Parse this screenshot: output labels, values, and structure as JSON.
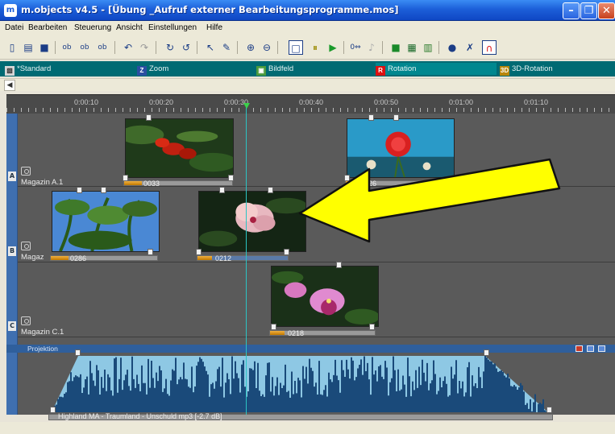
{
  "window": {
    "title": "m.objects v4.5 - [Übung _Aufruf externer Bearbeitungsprogramme.mos]",
    "app_icon": "m-objects-logo",
    "controls": [
      "minimize",
      "maximize",
      "close"
    ]
  },
  "menu": [
    "Datei",
    "Bearbeiten",
    "Steuerung",
    "Ansicht",
    "Einstellungen",
    "Hilfe"
  ],
  "toolbar_icons": [
    "new-document-icon",
    "open-folder-icon",
    "save-disk-icon",
    "obj-icon",
    "obj-add-icon",
    "obj-icon",
    "undo-icon",
    "redo-icon",
    "refresh-icon",
    "refresh-alt-icon",
    "pointer-icon",
    "wand-icon",
    "zoom-in-icon",
    "zoom-out-icon",
    "square-icon",
    "pause-icon",
    "play-icon",
    "step-icon",
    "mic-icon",
    "stop-icon",
    "grid-icon",
    "film-icon",
    "palette-icon",
    "wrench-icon",
    "magnet-icon"
  ],
  "tracks": {
    "standard": "*Standard",
    "zoom": "Zoom",
    "bildfeld": "Bildfeld",
    "rotation": "Rotation",
    "rotation_3d": "3D-Rotation"
  },
  "ruler": [
    "0:00:10",
    "0:00:20",
    "0:00:30",
    "0:00:40",
    "0:00:50",
    "0:01:00",
    "0:01:10"
  ],
  "lanes": {
    "a": {
      "letter": "A",
      "label": "Magazin A.1"
    },
    "b": {
      "letter": "B",
      "label": "Magaz"
    },
    "c": {
      "letter": "C",
      "label": "Magazin C.1"
    }
  },
  "clips": {
    "a1": {
      "label": "0033"
    },
    "a2": {
      "label": "0226"
    },
    "b1": {
      "label": "0286"
    },
    "b2": {
      "label": "0212"
    },
    "c1": {
      "label": "0218"
    }
  },
  "projection": {
    "title": "Projektion",
    "audio_label": "Highland MA - Traumland - Unschuld mp3 [-2.7 dB]"
  }
}
